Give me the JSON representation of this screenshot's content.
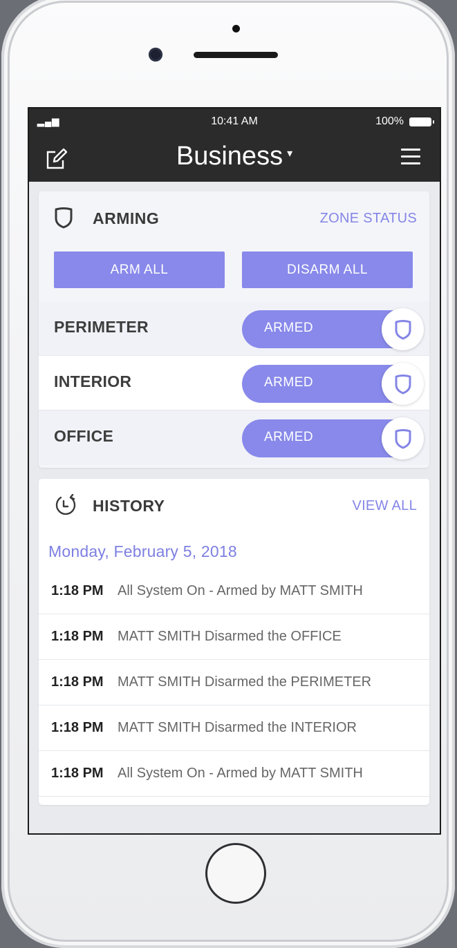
{
  "status_bar": {
    "signal": "▂▄▆",
    "time": "10:41 AM",
    "battery": "100%"
  },
  "nav": {
    "title": "Business",
    "caret": "▾",
    "edit_icon": "edit-icon",
    "menu_icon": "hamburger-menu-icon"
  },
  "arming": {
    "title": "ARMING",
    "link": "ZONE STATUS",
    "icon": "shield-icon",
    "arm_all_label": "ARM ALL",
    "disarm_all_label": "DISARM ALL",
    "zones": [
      {
        "name": "PERIMETER",
        "state": "ARMED"
      },
      {
        "name": "INTERIOR",
        "state": "ARMED"
      },
      {
        "name": "OFFICE",
        "state": "ARMED"
      }
    ]
  },
  "history": {
    "title": "HISTORY",
    "link": "VIEW ALL",
    "icon": "history-clock-icon",
    "date": "Monday, February 5, 2018",
    "entries": [
      {
        "time": "1:18 PM",
        "text": "All System On - Armed by MATT SMITH"
      },
      {
        "time": "1:18 PM",
        "text": "MATT SMITH Disarmed the OFFICE"
      },
      {
        "time": "1:18 PM",
        "text": "MATT SMITH Disarmed the PERIMETER"
      },
      {
        "time": "1:18 PM",
        "text": "MATT SMITH Disarmed the INTERIOR"
      },
      {
        "time": "1:18 PM",
        "text": "All System On - Armed by MATT SMITH"
      }
    ]
  },
  "colors": {
    "accent": "#8889ea",
    "accent_text": "#8485e6",
    "nav_bg": "#2b2b2b"
  }
}
